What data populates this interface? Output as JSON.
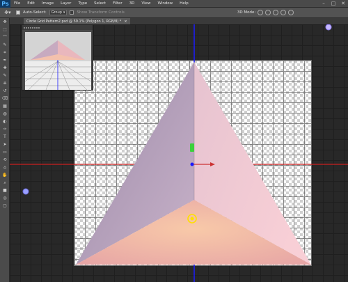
{
  "app": {
    "logo": "Ps",
    "menu": [
      "File",
      "Edit",
      "Image",
      "Layer",
      "Type",
      "Select",
      "Filter",
      "3D",
      "View",
      "Window",
      "Help"
    ],
    "window_controls": [
      "–",
      "□",
      "✕"
    ]
  },
  "options": {
    "tool_icon": "move-tool-icon",
    "auto_select_label": "Auto-Select:",
    "auto_select_checked": true,
    "auto_select_value": "Group",
    "show_transform_label": "Show Transform Controls",
    "show_transform_checked": false,
    "mode_label": "3D Mode:"
  },
  "document": {
    "tab_title": "Circle Grid Pattern2.psd @ 59.1% (Polygon 1, RGB/8) *",
    "tab_close": "×"
  },
  "colors": {
    "accent_blue": "#1a1aff",
    "guide_red": "#cc1e1e",
    "face_left": "#b8a3c1",
    "face_right": "#f3c4cc",
    "face_bottom": "#f1b9a4",
    "widget_yellow": "#ffe000",
    "widget_green": "#3bd13b"
  },
  "tools": [
    "move-icon",
    "marquee-icon",
    "lasso-icon",
    "quick-select-icon",
    "crop-icon",
    "eyedropper-icon",
    "healing-icon",
    "brush-icon",
    "stamp-icon",
    "history-brush-icon",
    "eraser-icon",
    "gradient-icon",
    "blur-icon",
    "dodge-icon",
    "pen-icon",
    "type-icon",
    "path-select-icon",
    "shape-icon",
    "3d-rotate-icon",
    "3d-camera-icon",
    "hand-icon",
    "zoom-icon",
    "color-swatch-icon",
    "quick-mask-icon",
    "screen-mode-icon"
  ],
  "tool_glyphs": [
    "✥",
    "⬚",
    "⌒",
    "✎",
    "⌗",
    "✒",
    "✚",
    "✎",
    "⎈",
    "↺",
    "⌫",
    "▦",
    "◍",
    "◐",
    "✑",
    "T",
    "➤",
    "▭",
    "⟲",
    "⌂",
    "✋",
    "⌕",
    "■",
    "◎",
    "▢"
  ]
}
